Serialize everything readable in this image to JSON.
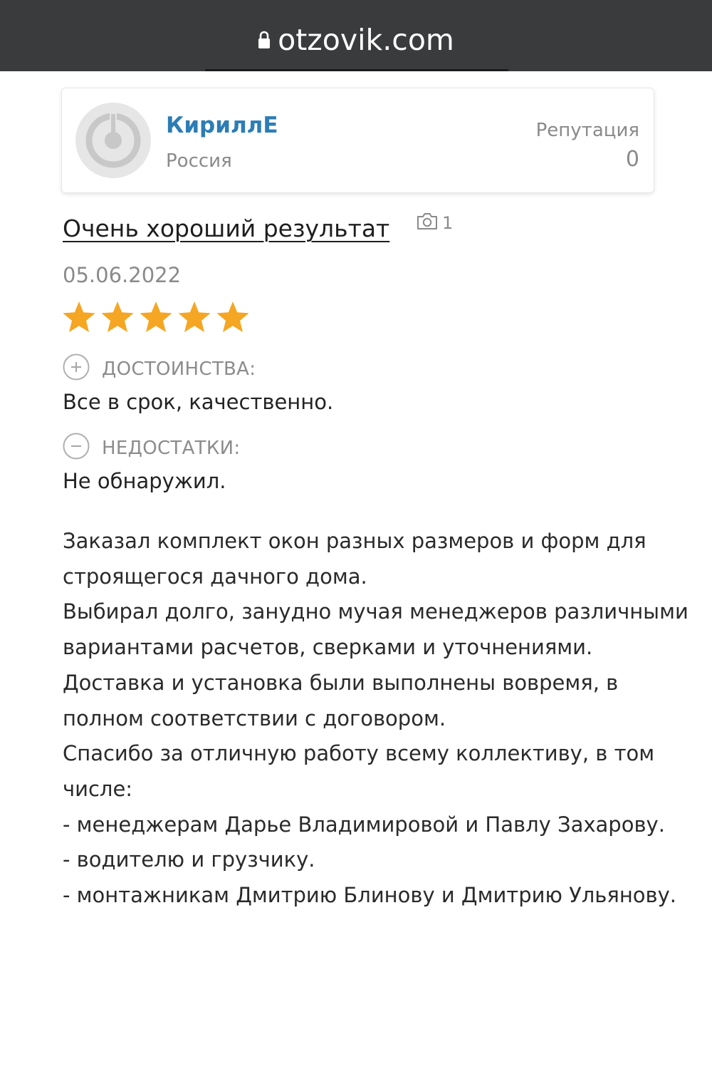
{
  "browser": {
    "url": "otzovik.com"
  },
  "author": {
    "name": "КириллЕ",
    "country": "Россия",
    "reputation_label": "Репутация",
    "reputation_value": "0"
  },
  "review": {
    "title": "Очень хороший результат",
    "photo_count": "1",
    "date": "05.06.2022",
    "rating": 5,
    "rating_max": 5,
    "pros_label": "ДОСТОИНСТВА:",
    "pros_text": "Все в срок, качественно.",
    "cons_label": "НЕДОСТАТКИ:",
    "cons_text": "Не обнаружил.",
    "body": "Заказал комплект окон разных размеров и форм для строящегося дачного дома.\nВыбирал долго, занудно мучая менеджеров различными вариантами расчетов, сверками и уточнениями.\nДоставка и установка были выполнены вовремя, в полном соответствии с договором.\nСпасибо за отличную работу всему коллективу, в том числе:\n- менеджерам Дарье Владимировой и Павлу Захарову.\n- водителю и грузчику.\n- монтажникам Дмитрию Блинову и Дмитрию Ульянову."
  },
  "colors": {
    "topbar": "#3a3b3d",
    "username": "#2d7db5",
    "star": "#f5a623",
    "muted": "#8a8a8a"
  }
}
